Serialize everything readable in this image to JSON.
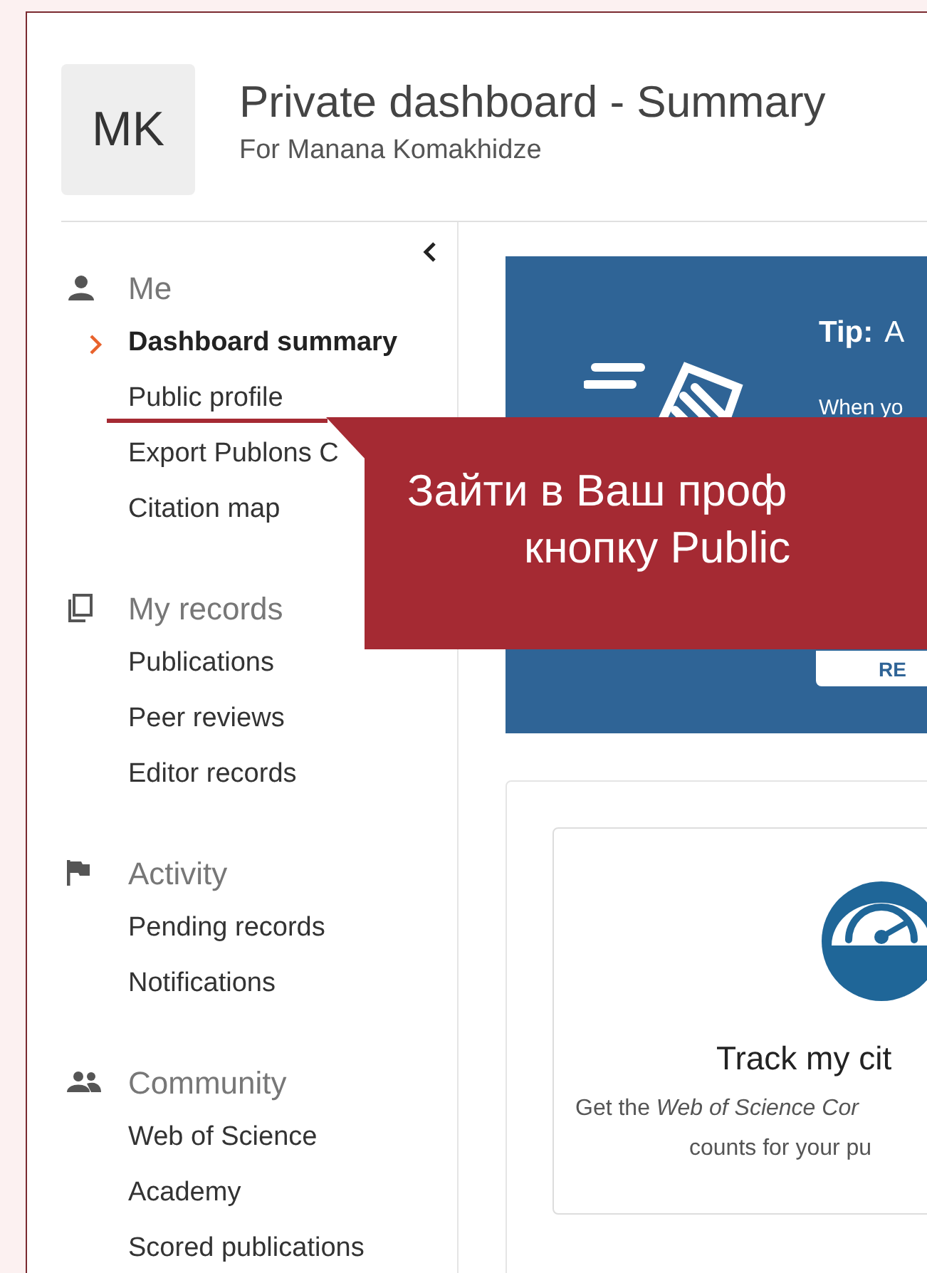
{
  "header": {
    "avatar": "MK",
    "title": "Private dashboard - Summary",
    "subtitle": "For Manana Komakhidze"
  },
  "sidebar": {
    "sections": [
      {
        "kind": "person",
        "label": "Me",
        "items": [
          {
            "label": "Dashboard summary",
            "selected": true
          },
          {
            "label": "Public profile",
            "selected": false
          },
          {
            "label": "Export Publons C",
            "selected": false
          },
          {
            "label": "Citation map",
            "selected": false
          }
        ]
      },
      {
        "kind": "records",
        "label": "My records",
        "items": [
          {
            "label": "Publications",
            "selected": false
          },
          {
            "label": "Peer reviews",
            "selected": false
          },
          {
            "label": "Editor records",
            "selected": false
          }
        ]
      },
      {
        "kind": "flag",
        "label": "Activity",
        "items": [
          {
            "label": "Pending records",
            "selected": false
          },
          {
            "label": "Notifications",
            "selected": false
          }
        ]
      },
      {
        "kind": "people",
        "label": "Community",
        "items": [
          {
            "label": "Web of Science",
            "selected": false
          },
          {
            "label": "Academy",
            "selected": false
          },
          {
            "label": "Scored publications",
            "selected": false
          }
        ]
      }
    ]
  },
  "tip": {
    "title": "Tip:",
    "title_rest": "A",
    "text": "When yo",
    "button": "RE"
  },
  "callout": {
    "lines": [
      "Зайти в Ваш проф",
      "кнопку Public"
    ]
  },
  "citations_card": {
    "title": "Track my cit",
    "description_lines": [
      "Get the *Web of Science Cor*",
      "counts for your pu"
    ]
  }
}
